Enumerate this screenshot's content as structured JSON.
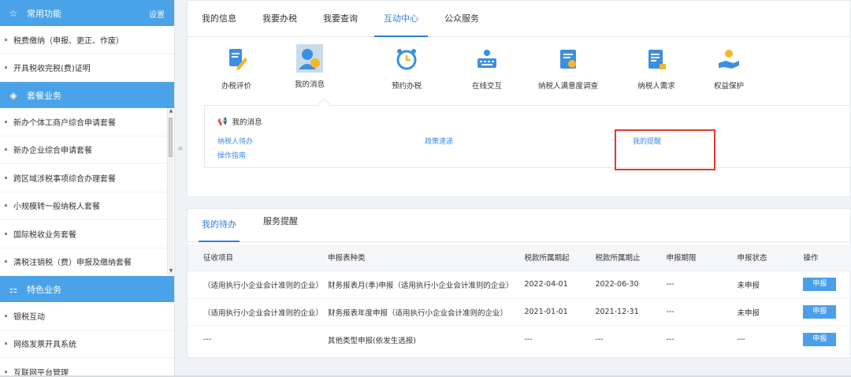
{
  "sidebar": {
    "common": {
      "title": "常用功能",
      "settings": "设置",
      "items": [
        {
          "label": "税费缴纳（申报、更正、作废）"
        },
        {
          "label": "开具税收完税(费)证明"
        }
      ]
    },
    "package": {
      "title": "套餐业务",
      "items": [
        {
          "label": "新办个体工商户综合申请套餐"
        },
        {
          "label": "新办企业综合申请套餐"
        },
        {
          "label": "跨区域涉税事项综合办理套餐"
        },
        {
          "label": "小规模转一般纳税人套餐"
        },
        {
          "label": "国际税收业务套餐"
        },
        {
          "label": "清税注销税（费）申报及缴纳套餐"
        }
      ]
    },
    "special": {
      "title": "特色业务",
      "items": [
        {
          "label": "银税互动"
        },
        {
          "label": "网络发票开具系统"
        },
        {
          "label": "互联网平台管理"
        }
      ]
    }
  },
  "collapse_glyph": "«",
  "top": {
    "tabs": [
      {
        "label": "我的信息",
        "active": false
      },
      {
        "label": "我要办税",
        "active": false
      },
      {
        "label": "我要查询",
        "active": false
      },
      {
        "label": "互动中心",
        "active": true
      },
      {
        "label": "公众服务",
        "active": false
      }
    ],
    "icons": [
      {
        "label": "办税评价",
        "icon": "edit-doc-icon"
      },
      {
        "label": "我的消息",
        "icon": "user-message-icon"
      },
      {
        "label": "预约办税",
        "icon": "alarm-clock-icon"
      },
      {
        "label": "在线交互",
        "icon": "keyboard-icon"
      },
      {
        "label": "纳税人满意度调查",
        "icon": "survey-icon"
      },
      {
        "label": "纳税人需求",
        "icon": "request-doc-icon"
      },
      {
        "label": "权益保护",
        "icon": "hand-protect-icon"
      }
    ],
    "messages": {
      "title": "我的消息",
      "links": {
        "todo": "纳税人待办",
        "policy": "政策速递",
        "reminder": "我的提醒",
        "guide": "操作指南"
      }
    }
  },
  "bottom": {
    "tabs": [
      {
        "label": "我的待办",
        "active": true
      },
      {
        "label": "服务提醒",
        "active": false
      }
    ],
    "table": {
      "headers": [
        "征收项目",
        "申报表种类",
        "税款所属期起",
        "税款所属期止",
        "申报期限",
        "申报状态",
        "操作"
      ],
      "rows": [
        [
          "（适用执行小企业会计准则的企业）",
          "财务报表月(季)申报（适用执行小企业会计准则的企业）",
          "2022-04-01",
          "2022-06-30",
          "---",
          "未申报",
          "申报"
        ],
        [
          "（适用执行小企业会计准则的企业）",
          "财务报表年度申报（适用执行小企业会计准则的企业）",
          "2021-01-01",
          "2021-12-31",
          "---",
          "未申报",
          "申报"
        ],
        [
          "---",
          "其他类型申报(依发生选报)",
          "---",
          "---",
          "---",
          "---",
          "申报"
        ]
      ]
    }
  },
  "colors": {
    "accent": "#2f7fd8",
    "sidebar_header": "#4aa3e8",
    "highlight_box": "#e0392a",
    "button": "#4a9fe8"
  }
}
